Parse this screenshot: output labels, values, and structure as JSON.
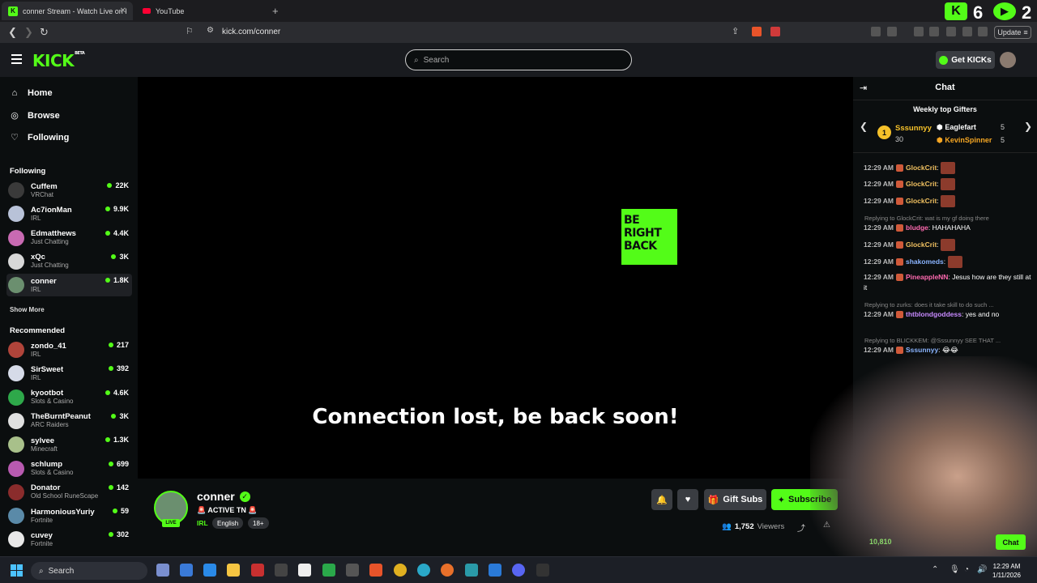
{
  "browser": {
    "tabs": [
      {
        "title": "conner Stream - Watch Live on K",
        "active": true
      },
      {
        "title": "YouTube",
        "active": false
      }
    ],
    "url": "kick.com/conner",
    "update_label": "Update",
    "corner_counts": [
      "6",
      "2"
    ]
  },
  "header": {
    "logo": "KICK",
    "logo_badge": "BETA",
    "search_placeholder": "Search",
    "get_kicks": "Get KICKs"
  },
  "sidebar": {
    "nav": [
      {
        "label": "Home",
        "icon": "home-icon"
      },
      {
        "label": "Browse",
        "icon": "compass-icon"
      },
      {
        "label": "Following",
        "icon": "heart-icon"
      }
    ],
    "following_heading": "Following",
    "following": [
      {
        "name": "Cuffem",
        "category": "VRChat",
        "viewers": "22K",
        "color": "#3a3a3a"
      },
      {
        "name": "Ac7ionMan",
        "category": "IRL",
        "viewers": "9.9K",
        "color": "#b8c2d8"
      },
      {
        "name": "Edmatthews",
        "category": "Just Chatting",
        "viewers": "4.4K",
        "color": "#c86ab2"
      },
      {
        "name": "xQc",
        "category": "Just Chatting",
        "viewers": "3K",
        "color": "#d8d8d8"
      },
      {
        "name": "conner",
        "category": "IRL",
        "viewers": "1.8K",
        "color": "#6b8f6f"
      }
    ],
    "show_more": "Show More",
    "recommended_heading": "Recommended",
    "recommended": [
      {
        "name": "zondo_41",
        "category": "IRL",
        "viewers": "217",
        "color": "#b0443a"
      },
      {
        "name": "SirSweet",
        "category": "IRL",
        "viewers": "392",
        "color": "#d6dbe8"
      },
      {
        "name": "kyootbot",
        "category": "Slots & Casino",
        "viewers": "4.6K",
        "color": "#2ea84a"
      },
      {
        "name": "TheBurntPeanut",
        "category": "ARC Raiders",
        "viewers": "3K",
        "color": "#e0e0e0"
      },
      {
        "name": "sylvee",
        "category": "Minecraft",
        "viewers": "1.3K",
        "color": "#a8c08a"
      },
      {
        "name": "schlump",
        "category": "Slots & Casino",
        "viewers": "699",
        "color": "#b85ab0"
      },
      {
        "name": "Donator",
        "category": "Old School RuneScape",
        "viewers": "142",
        "color": "#8a2c2c"
      },
      {
        "name": "HarmoniousYuriy",
        "category": "Fortnite",
        "viewers": "59",
        "color": "#5a8aa8"
      },
      {
        "name": "cuvey",
        "category": "Fortnite",
        "viewers": "302",
        "color": "#e8e8e8"
      }
    ]
  },
  "player": {
    "brb_text": "BE RIGHT BACK",
    "message": "Connection lost, be back soon!"
  },
  "stream": {
    "name": "conner",
    "title": "🚨 ACTIVE TN 🚨",
    "category": "IRL",
    "tags": [
      "English",
      "18+"
    ],
    "live_label": "LIVE",
    "gift_subs": "Gift Subs",
    "subscribe": "Subscribe",
    "viewers": "1,752",
    "viewers_label": "Viewers"
  },
  "chat": {
    "title": "Chat",
    "top_gifters_heading": "Weekly top Gifters",
    "gifters": [
      {
        "rank": "1",
        "name": "Sssunnyy",
        "count": "30"
      },
      {
        "name": "Eaglefart",
        "count": "5"
      },
      {
        "name": "KevinSpinner",
        "count": "5"
      }
    ],
    "messages": [
      {
        "time": "12:29 AM",
        "user": "GlockCrit",
        "color": "#f0c060",
        "text": "",
        "emote": true
      },
      {
        "time": "12:29 AM",
        "user": "GlockCrit",
        "color": "#f0c060",
        "text": "",
        "emote": true
      },
      {
        "time": "12:29 AM",
        "user": "GlockCrit",
        "color": "#f0c060",
        "text": "",
        "emote": true
      },
      {
        "reply": "Replying to GlockCrit: wat is my gf doing there"
      },
      {
        "time": "12:29 AM",
        "user": "bludge",
        "color": "#ff6ab0",
        "text": "HAHAHAHA"
      },
      {
        "time": "12:29 AM",
        "user": "GlockCrit",
        "color": "#f0c060",
        "text": "",
        "emote": true
      },
      {
        "time": "12:29 AM",
        "user": "shakomeds",
        "color": "#8ab4ff",
        "text": "",
        "emote": true
      },
      {
        "time": "12:29 AM",
        "user": "PineappleNN",
        "color": "#ff6ab0",
        "text": "Jesus how are they still at it"
      },
      {
        "reply": "Replying to zurks: does it take skill to do such ..."
      },
      {
        "time": "12:29 AM",
        "user": "thtblondgoddess",
        "color": "#c88aff",
        "text": "yes and no"
      },
      {
        "reply": "Replying to BLICKKEM: @Sssunnyy SEE THAT ..."
      },
      {
        "time": "12:29 AM",
        "user": "Sssunnyy",
        "color": "#8ab4ff",
        "text": "😂😂"
      }
    ],
    "kicks_count": "10,810",
    "chat_button": "Chat"
  },
  "taskbar": {
    "search_label": "Search",
    "time": "12:29 AM",
    "date": "1/11/2026"
  }
}
